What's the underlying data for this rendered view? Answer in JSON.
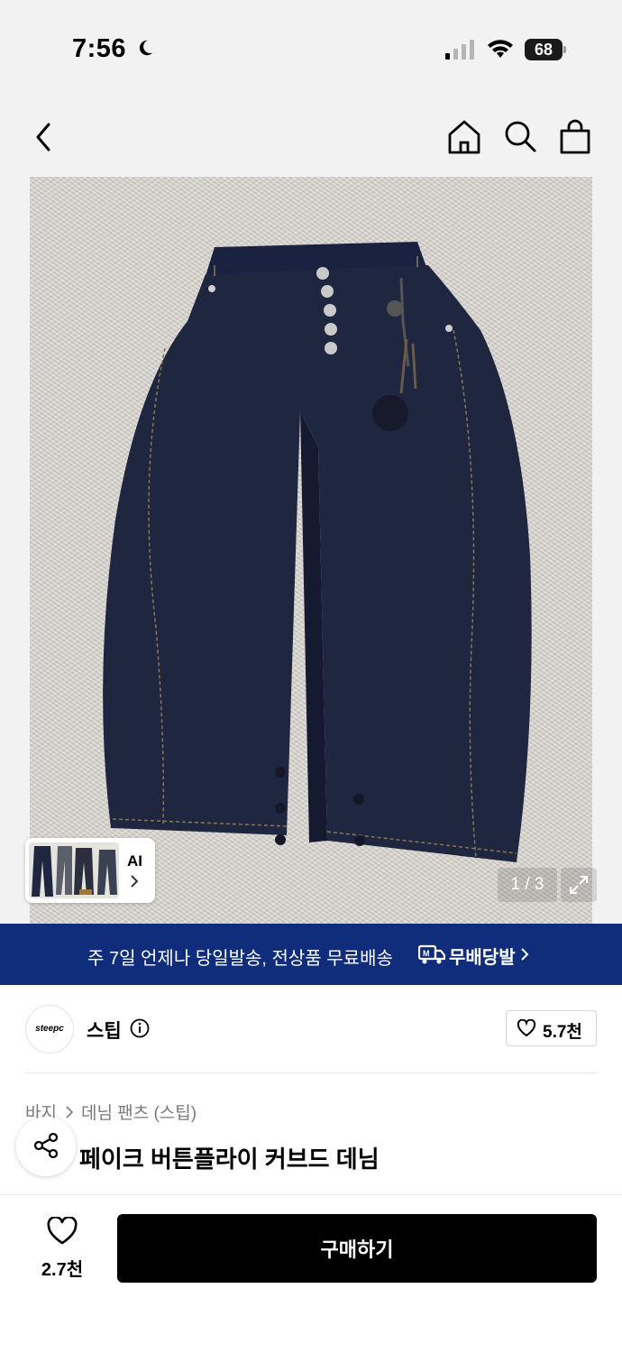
{
  "status_bar": {
    "time": "7:56",
    "battery": "68"
  },
  "gallery": {
    "page_counter": "1 / 3",
    "ai_label": "AI"
  },
  "banner": {
    "text": "주 7일 언제나 당일발송, 전상품 무료배송",
    "brand": "무배당발"
  },
  "brand": {
    "logo_text": "steepc",
    "name": "스팁",
    "like_count": "5.7천"
  },
  "breadcrumb": {
    "category": "바지",
    "subcategory": "데님 팬츠 (스팁)"
  },
  "product": {
    "title": "페이크 버튼플라이 커브드 데님"
  },
  "bottom_bar": {
    "wish_count": "2.7천",
    "buy_label": "구매하기"
  },
  "colors": {
    "banner_bg": "#0f2d7a",
    "denim": "#1f2640",
    "buy_bg": "#000000"
  }
}
